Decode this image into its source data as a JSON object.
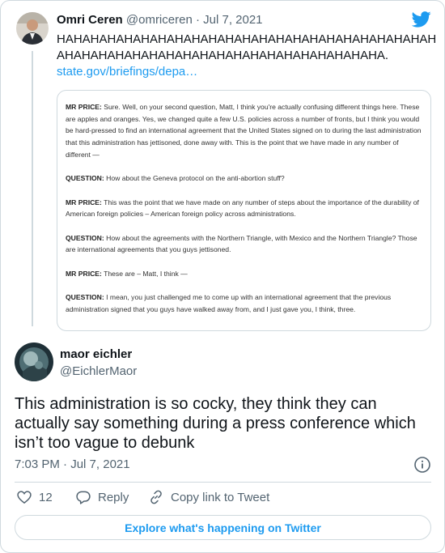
{
  "quoted": {
    "name": "Omri Ceren",
    "handle": "@omriceren",
    "dot": "·",
    "date": "Jul 7, 2021",
    "text": "HAHAHAHAHAHAHAHAHAHAHAHAHAHAHAHAHAHAHAHAHAHAHAHAHAHAHAHAHAHAHAHAHAHAHAHAHAHAHAHAHAHA.",
    "link": "state.gov/briefings/depa…",
    "transcript": [
      {
        "speaker": "MR PRICE:",
        "text": " Sure. Well, on your second question, Matt, I think you're actually confusing different things here. These are apples and oranges. Yes, we changed quite a few U.S. policies across a number of fronts, but I think you would be hard-pressed to find an international agreement that the United States signed on to during the last administration that this administration has jettisoned, done away with. This is the point that we have made in any number of different —"
      },
      {
        "speaker": "QUESTION:",
        "text": " How about the Geneva protocol on the anti-abortion stuff?"
      },
      {
        "speaker": "MR PRICE:",
        "text": " This was the point that we have made on any number of steps about the importance of the durability of American foreign policies – American foreign policy across administrations."
      },
      {
        "speaker": "QUESTION:",
        "text": " How about the agreements with the Northern Triangle, with Mexico and the Northern Triangle? Those are international agreements that you guys jettisoned."
      },
      {
        "speaker": "MR PRICE:",
        "text": " These are – Matt, I think —"
      },
      {
        "speaker": "QUESTION:",
        "text": " I mean, you just challenged me to come up with an international agreement that the previous administration signed that you guys have walked away from, and I just gave you, I think, three."
      }
    ]
  },
  "main": {
    "name": "maor eichler",
    "handle": "@EichlerMaor",
    "text": "This administration is so cocky, they think they can actually say something during a press conference which isn’t too vague to debunk",
    "time": "7:03 PM",
    "dot": "·",
    "date": "Jul 7, 2021"
  },
  "actions": {
    "likes": "12",
    "reply": "Reply",
    "copy": "Copy link to Tweet"
  },
  "explore": "Explore what's happening on Twitter",
  "colors": {
    "accent": "#1d9bf0",
    "secondary_text": "#536471",
    "border": "#cfd9de"
  }
}
